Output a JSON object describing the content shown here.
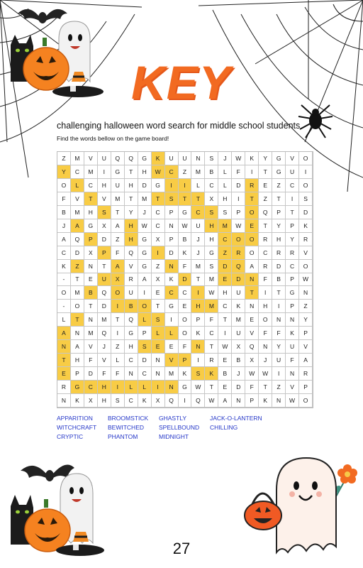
{
  "title": "KEY",
  "subtitle": "challenging halloween word search for middle school students",
  "instructions": "Find the words bellow on the game board!",
  "grid": [
    "ZMVUQQGKUUNSJWKYGVO",
    "YCMIGTHWCZMBLFITGUI",
    "OLCHUHDGIILCLDREZCO",
    "FVTVMTMTSTTXHITZTIS",
    "BMHSTYJCPGCSSPOQPTD",
    "JAGXAHWCNWUHMWETYPK",
    "AQPDZHGXPBJHCOORHYR",
    "CDXPFQGIDKJGZROCRRV",
    "KZNTAVGZNFMSDQARDCO",
    "-TEUXRAXKDTMEDNFBPW",
    "OMBQOUIECCIWHUTITGN",
    "-OTDIBOTGEHMCKNHIPZ",
    "LTNMTQLSIOPFTMEONNY",
    "ANMQIGPLLOKCIUVFFKP",
    "NAVJZHSEEFNTWXQNYUV",
    "THFVLCDNVPIREBXJUFA",
    "EPDFFNCNMKSKBJWWINR",
    "RGCHILLINGWTEDFTZVP",
    "NKXHSCKXQIQWANPKNWO"
  ],
  "highlight": [
    [
      7
    ],
    [
      0,
      7,
      8
    ],
    [
      1,
      8,
      9,
      14
    ],
    [
      2,
      7,
      8,
      9,
      10,
      14
    ],
    [
      3,
      10,
      11,
      14
    ],
    [
      1,
      5,
      11,
      12,
      14
    ],
    [
      2,
      5,
      12,
      13,
      14
    ],
    [
      3,
      7,
      12,
      13
    ],
    [
      1,
      4,
      8,
      12,
      13
    ],
    [
      3,
      4,
      9,
      12,
      13,
      14
    ],
    [
      2,
      4,
      8,
      10,
      14
    ],
    [
      4,
      5,
      6,
      10,
      11
    ],
    [
      1,
      6,
      7
    ],
    [
      0,
      7,
      8
    ],
    [
      0,
      6,
      7,
      10
    ],
    [
      0,
      8,
      9
    ],
    [
      0,
      10,
      11
    ],
    [
      1,
      2,
      3,
      4,
      5,
      6,
      7,
      8
    ],
    []
  ],
  "word_list": [
    [
      "APPARITION",
      "BROOMSTICK",
      "GHASTLY",
      "JACK-O-LANTERN"
    ],
    [
      "WITCHCRAFT",
      "BEWITCHED",
      "SPELLBOUND",
      "CHILLING"
    ],
    [
      "CRYPTIC",
      "PHANTOM",
      "MIDNIGHT",
      ""
    ]
  ],
  "page_number": "27",
  "colors": {
    "accent": "#f26a21",
    "highlight": "#f8cc45",
    "word_list": "#2436c8"
  },
  "decorations": [
    "spider-web",
    "bat",
    "ghost",
    "black-cat",
    "jack-o-lantern",
    "witch-hat",
    "spider",
    "ghost-with-pumpkin-basket",
    "flower"
  ]
}
